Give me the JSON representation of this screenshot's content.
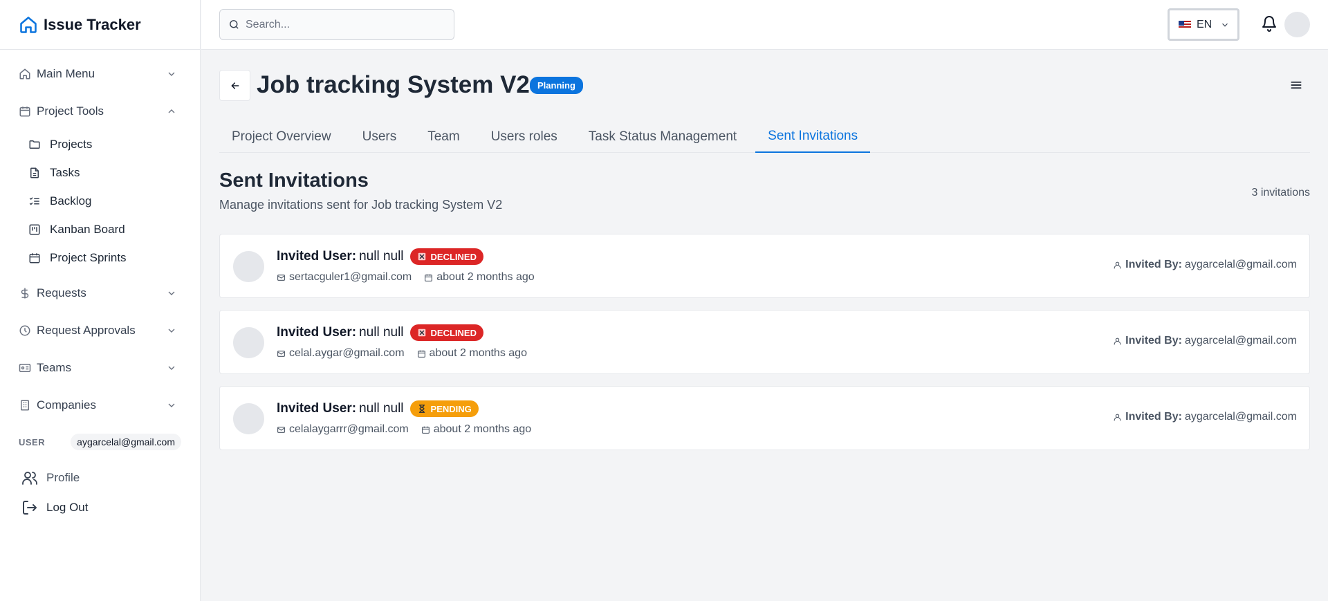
{
  "app": {
    "title": "Issue Tracker"
  },
  "sidebar": {
    "groups": [
      {
        "label": "Main Menu",
        "icon": "home-icon",
        "expanded": false
      },
      {
        "label": "Project Tools",
        "icon": "calendar-icon",
        "expanded": true,
        "items": [
          {
            "label": "Projects",
            "icon": "folder-icon"
          },
          {
            "label": "Tasks",
            "icon": "file-text-icon"
          },
          {
            "label": "Backlog",
            "icon": "list-checks-icon"
          },
          {
            "label": "Kanban Board",
            "icon": "kanban-icon"
          },
          {
            "label": "Project Sprints",
            "icon": "calendar-icon"
          }
        ]
      },
      {
        "label": "Requests",
        "icon": "dollar-icon",
        "expanded": false
      },
      {
        "label": "Request Approvals",
        "icon": "clock-icon",
        "expanded": false
      },
      {
        "label": "Teams",
        "icon": "id-card-icon",
        "expanded": false
      },
      {
        "label": "Companies",
        "icon": "building-icon",
        "expanded": false
      }
    ],
    "user_label": "USER",
    "user_email": "aygarcelal@gmail.com",
    "profile_label": "Profile",
    "logout_label": "Log Out"
  },
  "topbar": {
    "search_placeholder": "Search...",
    "language": "EN"
  },
  "project": {
    "title": "Job tracking System V2",
    "status": "Planning",
    "status_color": "#0b74de"
  },
  "tabs": [
    {
      "label": "Project Overview",
      "active": false
    },
    {
      "label": "Users",
      "active": false
    },
    {
      "label": "Team",
      "active": false
    },
    {
      "label": "Users roles",
      "active": false
    },
    {
      "label": "Task Status Management",
      "active": false
    },
    {
      "label": "Sent Invitations",
      "active": true
    }
  ],
  "invitations": {
    "title": "Sent Invitations",
    "subtitle": "Manage invitations sent for Job tracking System V2",
    "count_label": "3 invitations",
    "invited_user_label": "Invited User:",
    "invited_by_label": "Invited By:",
    "items": [
      {
        "name": "null null",
        "status": "DECLINED",
        "status_color": "#dc2626",
        "email": "sertacguler1@gmail.com",
        "time": "about 2 months ago",
        "invited_by": "aygarcelal@gmail.com"
      },
      {
        "name": "null null",
        "status": "DECLINED",
        "status_color": "#dc2626",
        "email": "celal.aygar@gmail.com",
        "time": "about 2 months ago",
        "invited_by": "aygarcelal@gmail.com"
      },
      {
        "name": "null null",
        "status": "PENDING",
        "status_color": "#f59e0b",
        "email": "celalaygarrr@gmail.com",
        "time": "about 2 months ago",
        "invited_by": "aygarcelal@gmail.com"
      }
    ]
  }
}
